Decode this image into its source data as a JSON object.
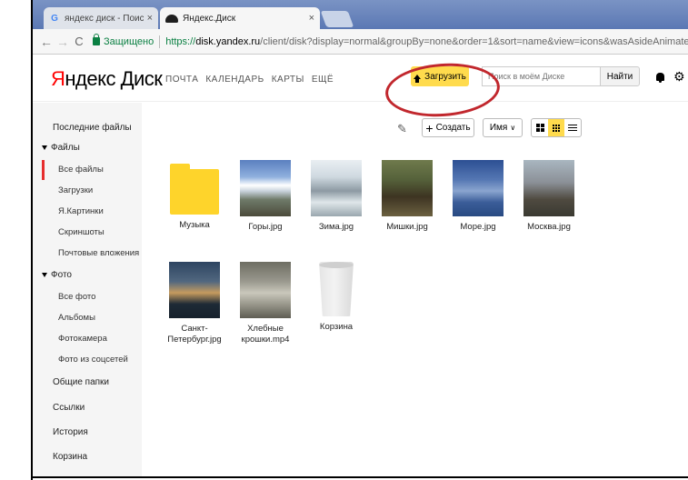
{
  "browser": {
    "tabs": [
      {
        "title": "яндекс диск - Поиск в G",
        "icon": "google-icon"
      },
      {
        "title": "Яндекс.Диск",
        "icon": "yandex-disk-icon"
      }
    ],
    "tab_close": "×",
    "nav_back": "←",
    "nav_forward": "→",
    "nav_reload": "C",
    "secure_label": "Защищено",
    "url_scheme": "https://",
    "url_host": "disk.yandex.ru",
    "url_rest": "/client/disk?display=normal&groupBy=none&order=1&sort=name&view=icons&wasAsideAnimated=false&typeClusterin"
  },
  "header": {
    "logo_part1": "Я",
    "logo_part2": "ндекс",
    "logo_part3": " Диск",
    "nav": [
      "ПОЧТА",
      "КАЛЕНДАРЬ",
      "КАРТЫ",
      "ЕЩЁ"
    ],
    "upload_label": "Загрузить",
    "search_placeholder": "Поиск в моём Диске",
    "search_button": "Найти",
    "gear": "⚙"
  },
  "sidebar": {
    "recent": "Последние файлы",
    "files_section": "Файлы",
    "files_items": [
      "Все файлы",
      "Загрузки",
      "Я.Картинки",
      "Скриншоты",
      "Почтовые вложения"
    ],
    "photo_section": "Фото",
    "photo_items": [
      "Все фото",
      "Альбомы",
      "Фотокамера",
      "Фото из соцсетей"
    ],
    "bottom_items": [
      "Общие папки",
      "Ссылки",
      "История",
      "Корзина"
    ]
  },
  "toolbar": {
    "clean_icon": "✎",
    "create_label": "Создать",
    "sort_label": "Имя",
    "sort_chevron": "∨"
  },
  "files": [
    {
      "name": "Музыка",
      "kind": "folder"
    },
    {
      "name": "Горы.jpg",
      "kind": "image"
    },
    {
      "name": "Зима.jpg",
      "kind": "image"
    },
    {
      "name": "Мишки.jpg",
      "kind": "image"
    },
    {
      "name": "Море.jpg",
      "kind": "image"
    },
    {
      "name": "Москва.jpg",
      "kind": "image"
    },
    {
      "name": "Санкт-Петербург.jpg",
      "kind": "image"
    },
    {
      "name": "Хлебные крошки.mp4",
      "kind": "video"
    },
    {
      "name": "Корзина",
      "kind": "trash"
    }
  ],
  "colors": {
    "accent_yellow": "#ffdb4d",
    "folder_yellow": "#fed42b",
    "annotation_red": "#c1272d",
    "active_red": "#e62e2e"
  }
}
